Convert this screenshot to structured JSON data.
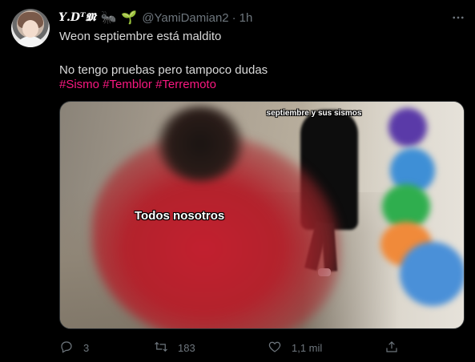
{
  "author": {
    "display_name": "𝒀.𝑫ᵀ𝕸",
    "emoji_1": "🐜",
    "emoji_2": "🌱",
    "handle": "@YamiDamian2",
    "separator": "·",
    "time": "1h"
  },
  "tweet": {
    "line1": "Weon septiembre está maldito",
    "line2": "No tengo pruebas pero tampoco dudas",
    "hashtags": [
      "#Sismo",
      "#Temblor",
      "#Terremoto"
    ]
  },
  "media": {
    "caption_top": "septiembre y sus sismos",
    "caption_center": "Todos nosotros"
  },
  "actions": {
    "reply_count": "3",
    "retweet_count": "183",
    "like_count": "1,1 mil"
  },
  "icons": {
    "more": "more-icon",
    "reply": "reply-icon",
    "retweet": "retweet-icon",
    "like": "like-icon",
    "share": "share-icon"
  },
  "colors": {
    "background": "#000000",
    "text": "#d9d9d9",
    "muted": "#6e767d",
    "hashtag": "#f91880"
  }
}
